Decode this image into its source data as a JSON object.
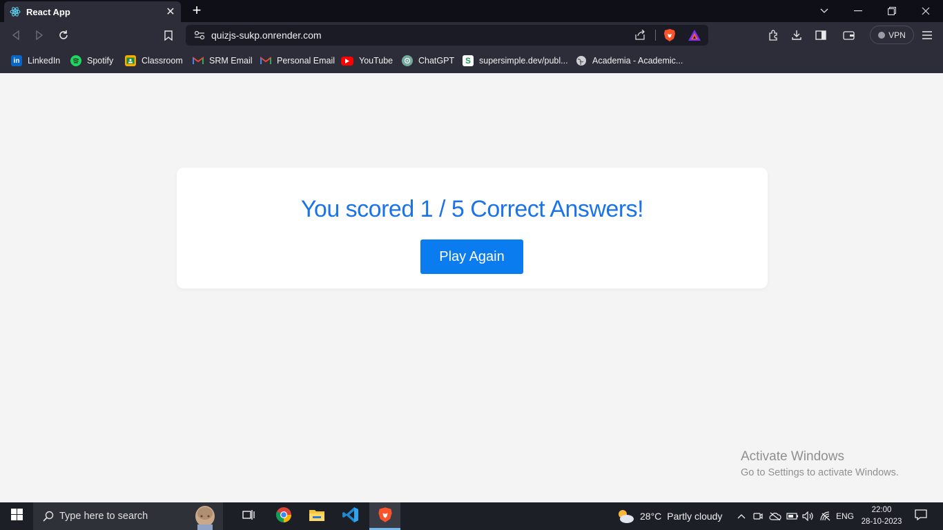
{
  "browser": {
    "tab": {
      "title": "React App",
      "favicon": "react-icon"
    },
    "url": "quizjs-sukp.onrender.com",
    "vpn_label": "VPN",
    "bookmarks": [
      {
        "label": "LinkedIn",
        "icon": "linkedin-icon"
      },
      {
        "label": "Spotify",
        "icon": "spotify-icon"
      },
      {
        "label": "Classroom",
        "icon": "classroom-icon"
      },
      {
        "label": "SRM Email",
        "icon": "gmail-icon"
      },
      {
        "label": "Personal Email",
        "icon": "gmail-icon"
      },
      {
        "label": "YouTube",
        "icon": "youtube-icon"
      },
      {
        "label": "ChatGPT",
        "icon": "chatgpt-icon"
      },
      {
        "label": "supersimple.dev/publ...",
        "icon": "supersimple-icon"
      },
      {
        "label": "Academia - Academic...",
        "icon": "globe-icon"
      }
    ]
  },
  "quiz": {
    "score_text": "You scored 1 / 5 Correct Answers!",
    "play_again_label": "Play Again"
  },
  "watermark": {
    "title": "Activate Windows",
    "subtitle": "Go to Settings to activate Windows."
  },
  "taskbar": {
    "search_placeholder": "Type here to search",
    "weather": {
      "temp": "28°C",
      "condition": "Partly cloudy"
    },
    "language": "ENG",
    "time": "22:00",
    "date": "28-10-2023"
  },
  "colors": {
    "accent": "#0b7bf0",
    "score_text": "#1a73e8",
    "page_bg": "#f4f4f4",
    "chrome_bg": "#2c2d39"
  }
}
